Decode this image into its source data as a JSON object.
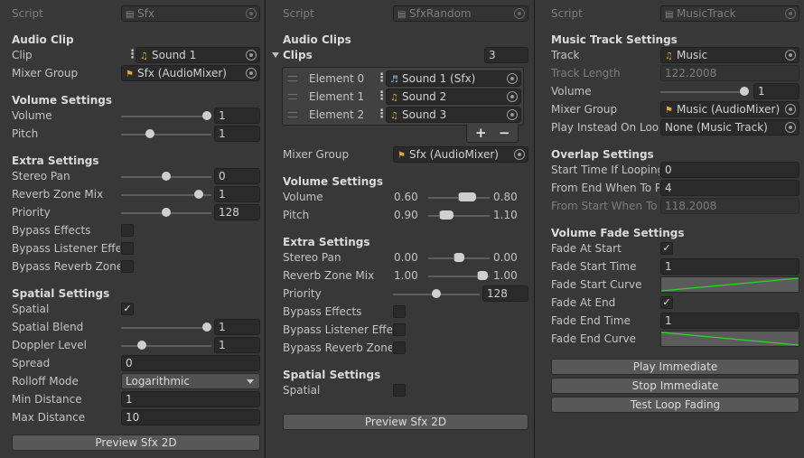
{
  "p1": {
    "script_label": "Script",
    "script_value": "Sfx",
    "audio_clip_header": "Audio Clip",
    "clip_label": "Clip",
    "clip_value": "Sound 1",
    "mixer_label": "Mixer Group",
    "mixer_value": "Sfx (AudioMixer)",
    "volume_header": "Volume Settings",
    "volume_label": "Volume",
    "volume_value": "1",
    "volume_fraction": 1.0,
    "pitch_label": "Pitch",
    "pitch_value": "1",
    "pitch_fraction": 0.3,
    "extra_header": "Extra Settings",
    "stereo_label": "Stereo Pan",
    "stereo_value": "0",
    "stereo_fraction": 0.5,
    "reverb_label": "Reverb Zone Mix",
    "reverb_value": "1",
    "reverb_fraction": 0.9,
    "priority_label": "Priority",
    "priority_value": "128",
    "priority_fraction": 0.5,
    "bypass_effects_label": "Bypass Effects",
    "bypass_listener_label": "Bypass Listener Effects",
    "bypass_reverb_label": "Bypass Reverb Zones",
    "spatial_header": "Spatial Settings",
    "spatial_label": "Spatial",
    "spatial_blend_label": "Spatial Blend",
    "spatial_blend_value": "1",
    "spatial_blend_fraction": 1.0,
    "doppler_label": "Doppler Level",
    "doppler_value": "1",
    "doppler_fraction": 0.2,
    "spread_label": "Spread",
    "spread_value": "0",
    "rolloff_label": "Rolloff Mode",
    "rolloff_value": "Logarithmic",
    "min_label": "Min Distance",
    "min_value": "1",
    "max_label": "Max Distance",
    "max_value": "10",
    "preview_button": "Preview Sfx 2D"
  },
  "p2": {
    "script_label": "Script",
    "script_value": "SfxRandom",
    "audio_clips_header": "Audio Clips",
    "clips_label": "Clips",
    "clips_count": "3",
    "elements": [
      {
        "label": "Element 0",
        "value": "Sound 1 (Sfx)"
      },
      {
        "label": "Element 1",
        "value": "Sound 2"
      },
      {
        "label": "Element 2",
        "value": "Sound 3"
      }
    ],
    "add_glyph": "+",
    "remove_glyph": "−",
    "mixer_label": "Mixer Group",
    "mixer_value": "Sfx (AudioMixer)",
    "volume_header": "Volume Settings",
    "volume_label": "Volume",
    "volume_min": "0.60",
    "volume_max": "0.80",
    "pitch_label": "Pitch",
    "pitch_min": "0.90",
    "pitch_max": "1.10",
    "extra_header": "Extra Settings",
    "stereo_label": "Stereo Pan",
    "stereo_min": "0.00",
    "stereo_max": "0.00",
    "reverb_label": "Reverb Zone Mix",
    "reverb_min": "1.00",
    "reverb_max": "1.00",
    "priority_label": "Priority",
    "priority_value": "128",
    "priority_fraction": 0.5,
    "bypass_effects_label": "Bypass Effects",
    "bypass_listener_label": "Bypass Listener Effects",
    "bypass_reverb_label": "Bypass Reverb Zones",
    "spatial_header": "Spatial Settings",
    "spatial_label": "Spatial",
    "preview_button": "Preview Sfx 2D"
  },
  "p3": {
    "script_label": "Script",
    "script_value": "MusicTrack",
    "music_header": "Music Track Settings",
    "track_label": "Track",
    "track_value": "Music",
    "track_length_label": "Track Length",
    "track_length_value": "122.2008",
    "volume_label": "Volume",
    "volume_value": "1",
    "volume_fraction": 1.0,
    "mixer_label": "Mixer Group",
    "mixer_value": "Music (AudioMixer)",
    "play_instead_label": "Play Instead On Loop",
    "play_instead_value": "None (Music Track)",
    "overlap_header": "Overlap Settings",
    "start_time_label": "Start Time If Looping",
    "start_time_value": "0",
    "from_end_label": "From End When To Play",
    "from_end_value": "4",
    "from_start_label": "From Start When To Play",
    "from_start_value": "118.2008",
    "fade_header": "Volume Fade Settings",
    "fade_start_label": "Fade At Start",
    "fade_start_time_label": "Fade Start Time",
    "fade_start_time_value": "1",
    "fade_start_curve_label": "Fade Start Curve",
    "fade_end_label": "Fade At End",
    "fade_end_time_label": "Fade End Time",
    "fade_end_time_value": "1",
    "fade_end_curve_label": "Fade End Curve",
    "play_button": "Play Immediate",
    "stop_button": "Stop Immediate",
    "test_button": "Test Loop Fading"
  },
  "icons": {
    "audio": "music-note-icon",
    "mixer": "mixer-flag-icon",
    "script": "script-icon",
    "picker": "object-picker-icon"
  },
  "colors": {
    "background": "#383838",
    "field": "#2a2a2a",
    "curve_line": "#2bd62b",
    "asset_icon": "#e0a93a"
  }
}
